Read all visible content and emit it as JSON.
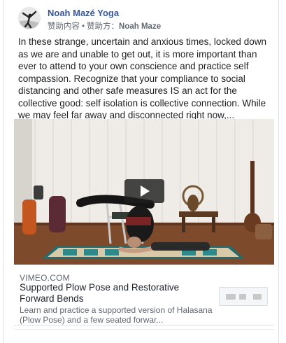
{
  "post": {
    "page_name": "Noah Mazé Yoga",
    "sponsored_label": "赞助内容",
    "separator": "•",
    "sponsor_prefix": "赞助方：",
    "sponsor_name": "Noah Maze",
    "text": "In these strange, uncertain and anxious times, locked down as we are and unable to get out, it is more important than ever to attend to your own conscience and practice self compassion. Recognize that your compliance to social distancing and other safe measures IS an act for the collective good: self isolation is collective connection. While we may feel far away and disconnected right now,..."
  },
  "link": {
    "domain": "VIMEO.COM",
    "title": "Supported Plow Pose and Restorative Forward Bends",
    "description": "Learn and practice a supported version of Halasana (Plow Pose) and a few seated forwar..."
  },
  "icons": {
    "play": "play-icon",
    "avatar": "yoga-avatar-icon"
  },
  "colors": {
    "page_name": "#385898",
    "meta": "#616770",
    "wall": "#f2f0ec",
    "floor": "#7a4a2c"
  }
}
